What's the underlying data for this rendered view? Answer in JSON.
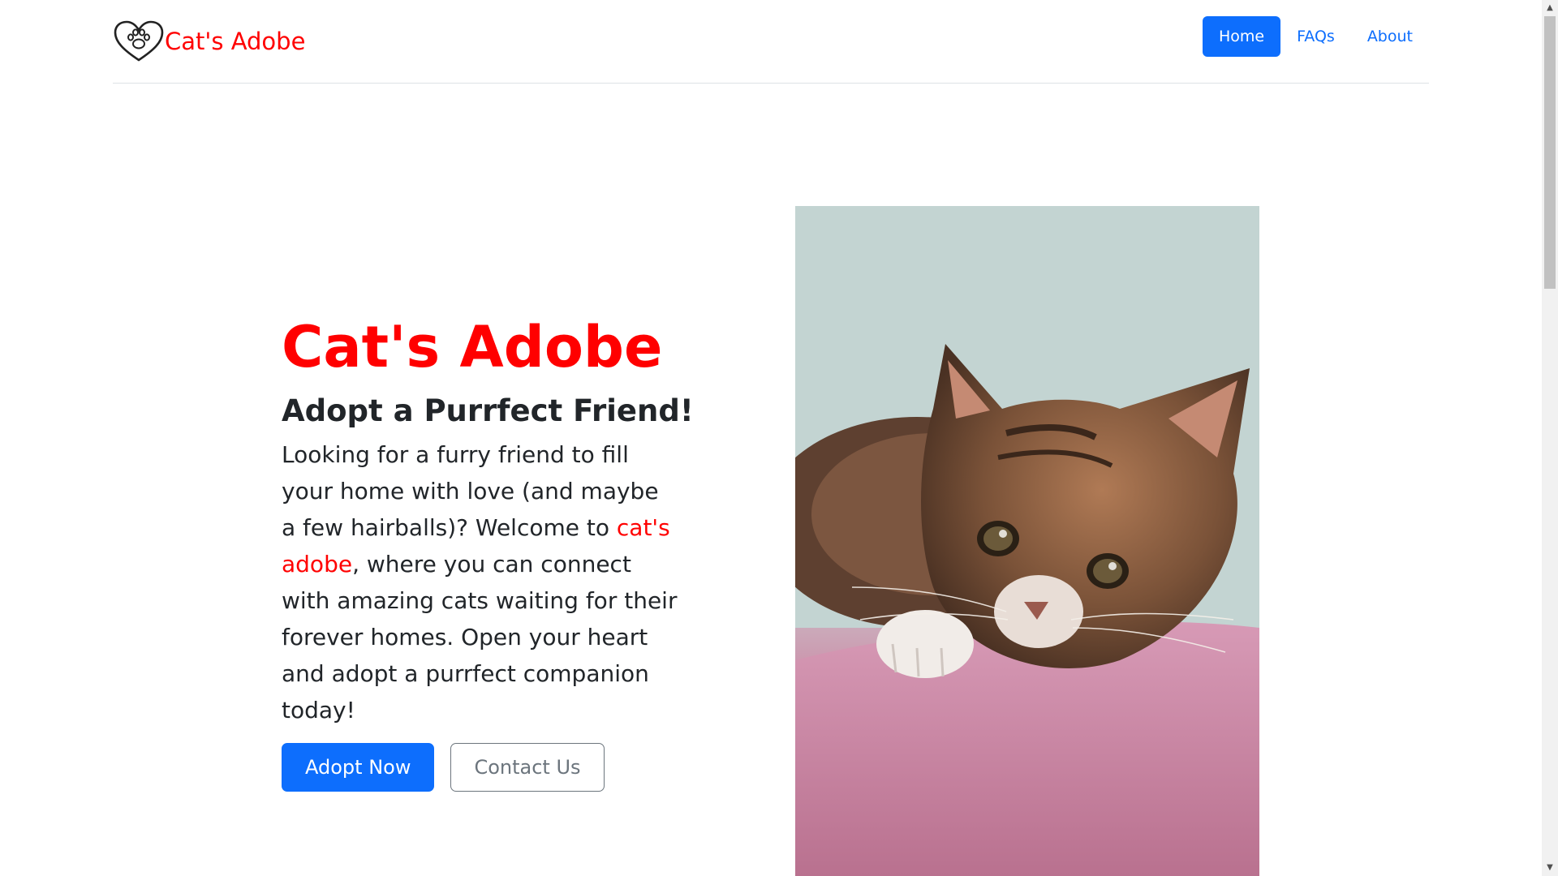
{
  "header": {
    "brand_text": "Cat's Adobe",
    "logo_icon": "heart-paw-icon",
    "nav": [
      {
        "label": "Home",
        "active": true
      },
      {
        "label": "FAQs",
        "active": false
      },
      {
        "label": "About",
        "active": false
      }
    ]
  },
  "hero": {
    "title": "Cat's Adobe",
    "subtitle": "Adopt a Purrfect Friend!",
    "body_before": "Looking for a furry friend to fill your home with love (and maybe a few hairballs)? Welcome to ",
    "body_highlight": "cat's adobe",
    "body_after": ", where you can connect with amazing cats waiting for their forever homes. Open your heart and adopt a purrfect companion today!",
    "primary_button": "Adopt Now",
    "secondary_button": "Contact Us",
    "image_subject": "kitten-photo"
  },
  "colors": {
    "brand": "#ff0000",
    "primary": "#0d6efd",
    "text": "#212529",
    "muted": "#6c757d"
  }
}
